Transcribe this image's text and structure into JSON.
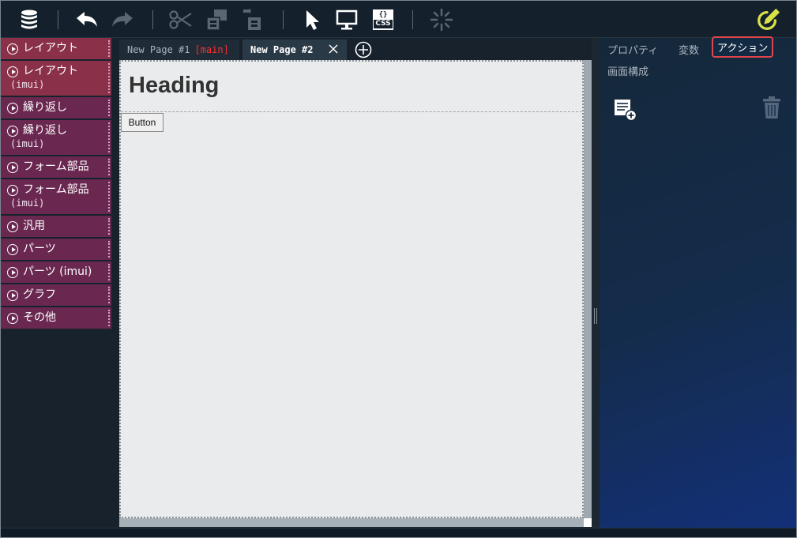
{
  "toolbar": {
    "icons": [
      "database-icon",
      "undo-icon",
      "redo-icon",
      "cut-icon",
      "copy-icon",
      "paste-icon",
      "pointer-icon",
      "monitor-icon",
      "css-icon",
      "loading-icon",
      "edit-icon"
    ],
    "css_label": "CSS",
    "css_braces": "{}"
  },
  "palette": {
    "items": [
      {
        "label": "レイアウト",
        "sub": ""
      },
      {
        "label": "レイアウト",
        "sub": "(imui)"
      },
      {
        "label": "繰り返し",
        "sub": ""
      },
      {
        "label": "繰り返し",
        "sub": "(imui)"
      },
      {
        "label": "フォーム部品",
        "sub": ""
      },
      {
        "label": "フォーム部品",
        "sub": "(imui)"
      },
      {
        "label": "汎用",
        "sub": ""
      },
      {
        "label": "パーツ",
        "sub": ""
      },
      {
        "label": "パーツ (imui)",
        "sub": ""
      },
      {
        "label": "グラフ",
        "sub": ""
      },
      {
        "label": "その他",
        "sub": ""
      }
    ],
    "colors": [
      "#8a3048",
      "#8a3048",
      "#6a2850",
      "#6a2850",
      "#6a2850",
      "#6a2850",
      "#6a2850",
      "#6a2850",
      "#6a2850",
      "#6a2850",
      "#6a2850"
    ]
  },
  "tabs": [
    {
      "label": "New Page #1",
      "tag": "[main]"
    },
    {
      "label": "New Page #2"
    }
  ],
  "canvas": {
    "heading": "Heading",
    "button_label": "Button"
  },
  "right_panel": {
    "tabs": [
      "プロパティ",
      "変数",
      "アクション",
      "画面構成"
    ],
    "active_tab": "アクション"
  },
  "colors": {
    "accent_red": "#e0454c",
    "main_tag": "#ff3030",
    "edit_icon": "#d9e048"
  }
}
